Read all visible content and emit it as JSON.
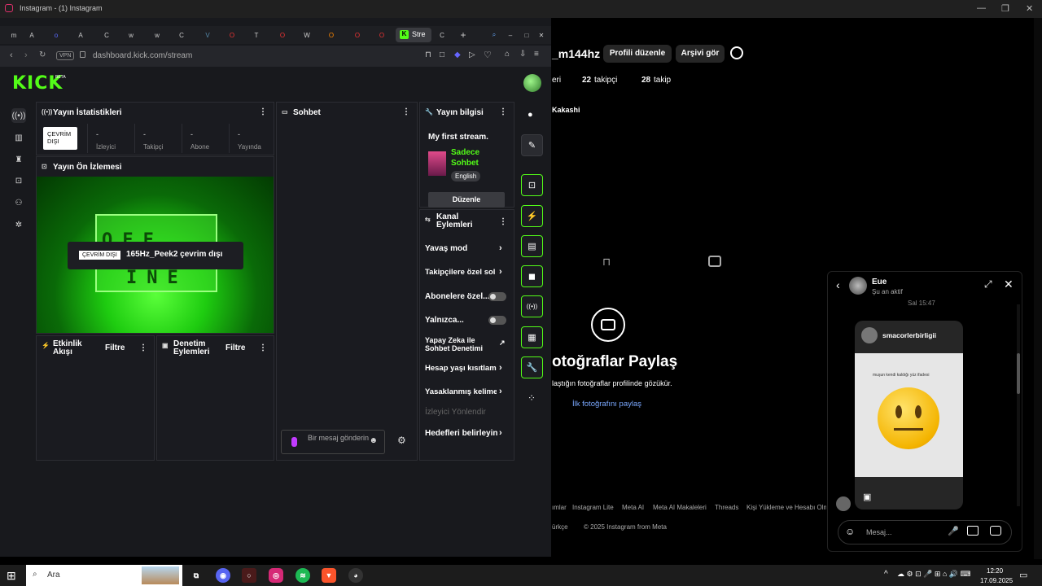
{
  "window": {
    "title": "Instagram - (1) Instagram"
  },
  "browser": {
    "tabs": [
      "m",
      "A",
      "o",
      "l",
      "A",
      "C",
      "w",
      "w",
      "C",
      "V",
      "O",
      "C",
      "T",
      "O",
      "W",
      "O",
      "b",
      "C"
    ],
    "active_tab": "Stre",
    "vpn_label": "VPN",
    "url": "dashboard.kick.com/stream"
  },
  "kick": {
    "logo": "KICK",
    "beta": "BETA",
    "stats": {
      "title": "Yayın İstatistikleri",
      "offline_btn": "ÇEVRİM DIŞI",
      "items": [
        {
          "v": "-",
          "l": "İzleyici"
        },
        {
          "v": "-",
          "l": "Takipçi"
        },
        {
          "v": "-",
          "l": "Abone"
        },
        {
          "v": "-",
          "l": "Yayında"
        }
      ]
    },
    "preview": {
      "title": "Yayın Ön İzlemesi",
      "badge": "ÇEVRİM DIŞI",
      "status": "165Hz_Peek2 çevrim dışı",
      "offline_text": [
        "O",
        "F",
        "F",
        "L",
        "I",
        "N",
        "E"
      ]
    },
    "chat": {
      "title": "Sohbet",
      "placeholder": "Bir mesaj gönderin"
    },
    "activity": {
      "title": "Etkinlik Akışı",
      "filter": "Filtre"
    },
    "moderation": {
      "title": "Denetim Eylemleri",
      "filter": "Filtre"
    },
    "info": {
      "title": "Yayın bilgisi",
      "stream_title": "My first stream.",
      "category": "Sadece Sohbet",
      "language": "English",
      "edit": "Düzenle"
    },
    "channel_actions": {
      "title": "Kanal Eylemleri",
      "items": [
        "Yavaş mod",
        "Takipçilere özel sol",
        "Abonelere özel...",
        "Yalnızca...",
        "Yapay Zeka ile Sohbet Denetimi",
        "Hesap yaşı kısıtlam",
        "Yasaklanmış kelime",
        "İzleyici Yönlendir",
        "Hedefleri belirleyin"
      ]
    }
  },
  "instagram": {
    "username": "_m144hz",
    "edit_profile": "Profili düzenle",
    "archive": "Arşivi gör",
    "posts_label": "eri",
    "followers": "22",
    "followers_label": "takipçi",
    "following": "28",
    "following_label": "takip",
    "bio_name": "Kakashi",
    "empty_title": "otoğraflar Paylaş",
    "empty_sub": "laştığın fotoğraflar profilinde gözükür.",
    "first_photo": "İlk fotoğrafını paylaş",
    "footer": [
      "ımlar",
      "Instagram Lite",
      "Meta AI",
      "Meta AI Makaleleri",
      "Threads",
      "Kişi Yükleme ve Hesabı Olma"
    ],
    "footer2": "ürkçe",
    "copyright": "© 2025 Instagram from Meta"
  },
  "dm": {
    "name": "Eue",
    "status": "Şu an aktif",
    "time": "Sal 15:47",
    "shared_user": "smacorlerbirligii",
    "caption": "muşun kendi kaldığı yüz ifadesi",
    "input_placeholder": "Mesaj..."
  },
  "taskbar": {
    "search": "Ara",
    "time": "12:20",
    "date": "17.09.2025"
  }
}
